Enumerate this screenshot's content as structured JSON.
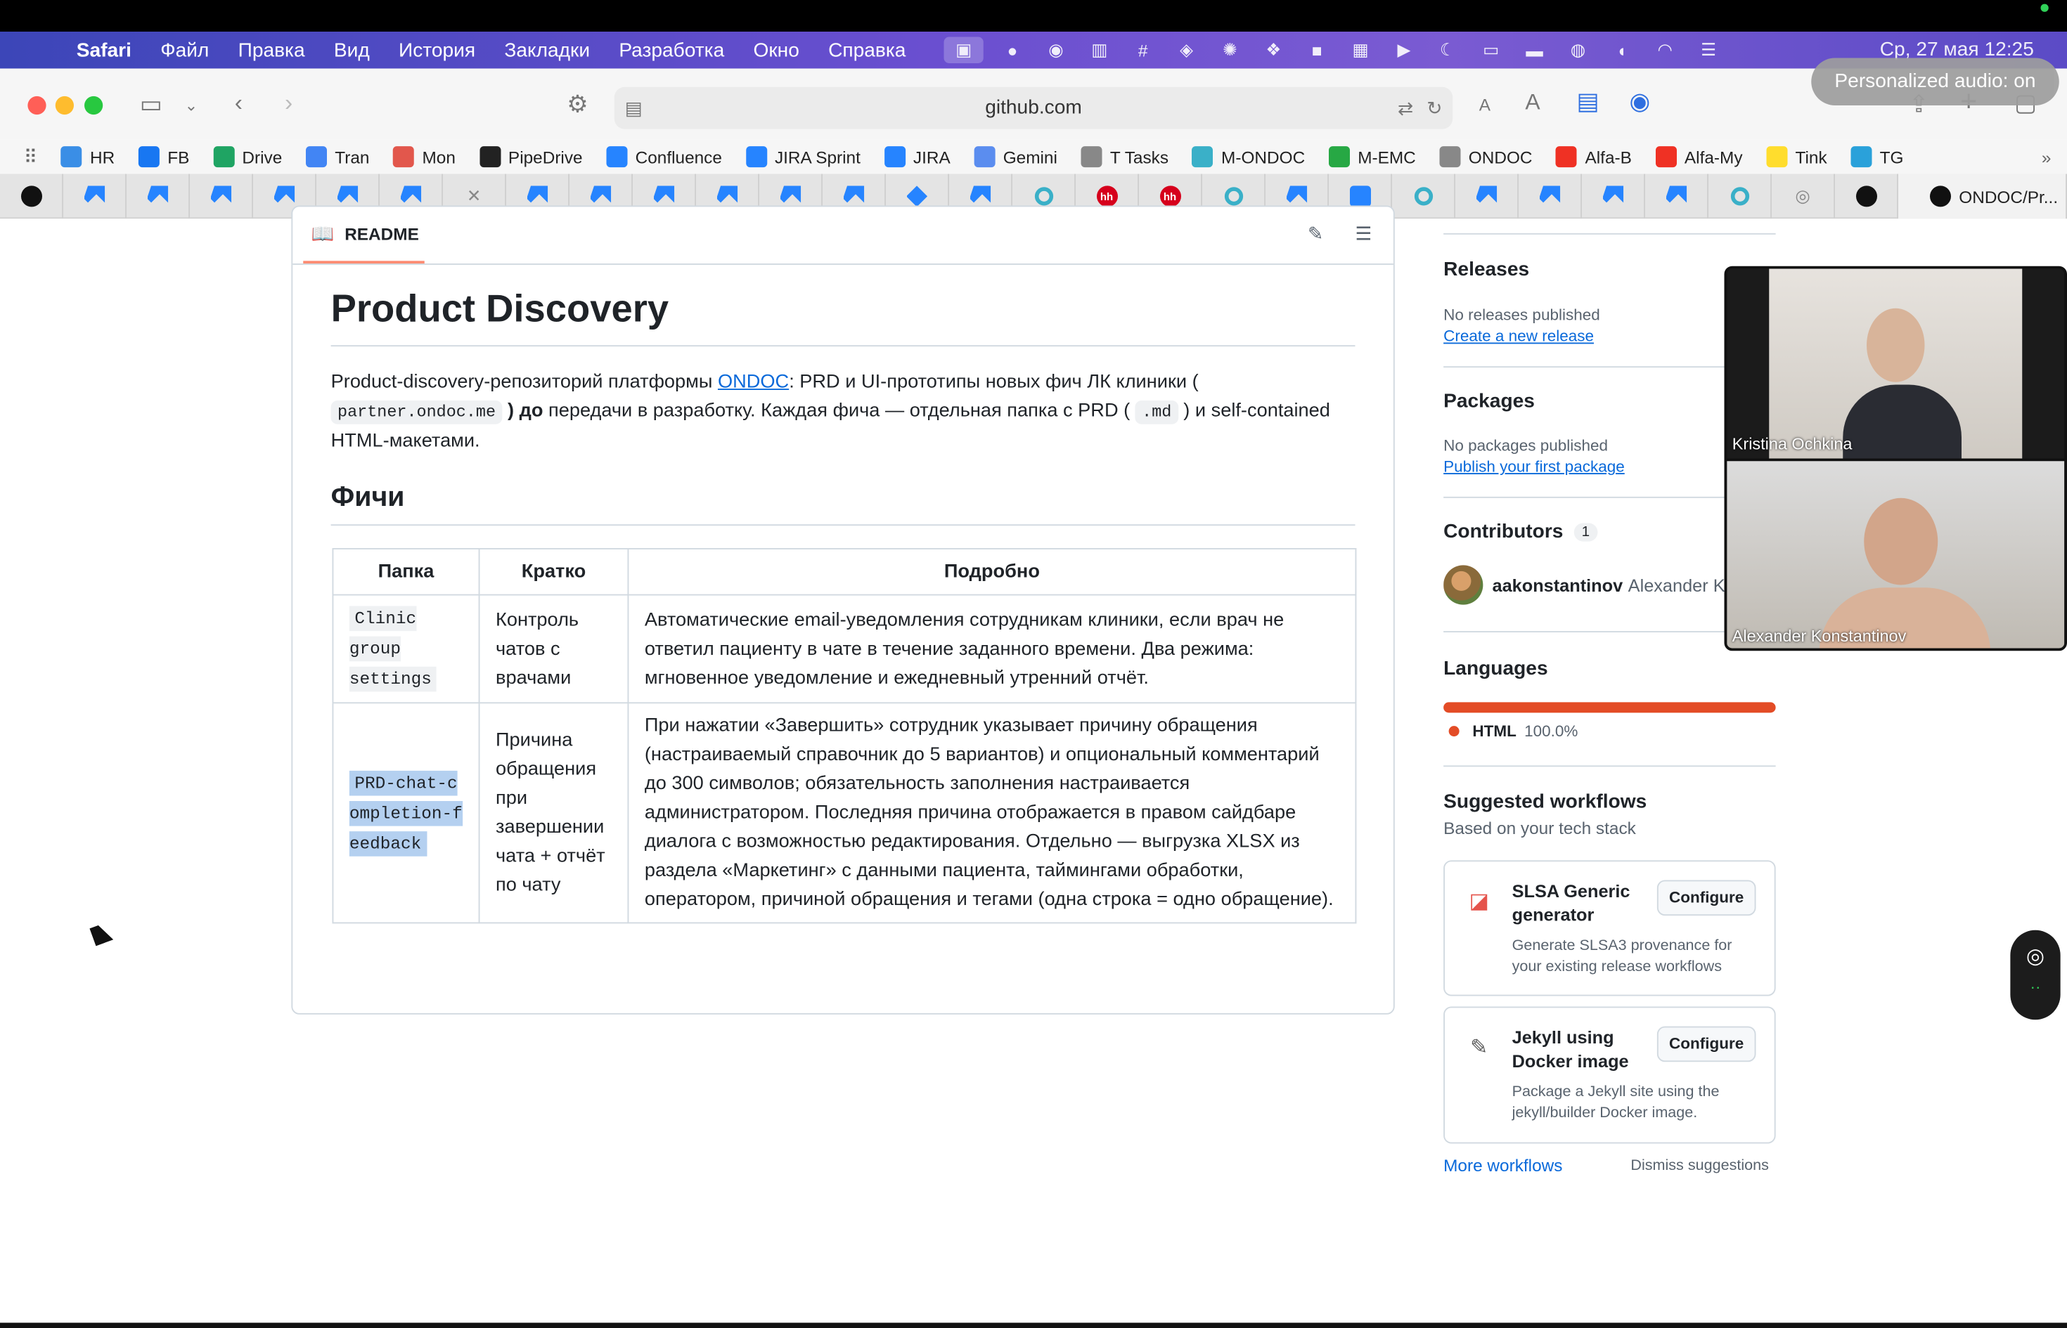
{
  "menubar": {
    "app": "Safari",
    "items": [
      "Файл",
      "Правка",
      "Вид",
      "История",
      "Закладки",
      "Разработка",
      "Окно",
      "Справка"
    ],
    "clock": "Ср, 27 мая  12:25"
  },
  "toolbar": {
    "url": "github.com",
    "personalized_audio": "Personalized audio: on"
  },
  "bookmarks": [
    {
      "label": "HR",
      "icon": "hr-icon",
      "color": "#3a8ee6"
    },
    {
      "label": "FB",
      "icon": "facebook-icon",
      "color": "#1877f2"
    },
    {
      "label": "Drive",
      "icon": "drive-icon",
      "color": "#1fa463"
    },
    {
      "label": "Tran",
      "icon": "translate-icon",
      "color": "#4285f4"
    },
    {
      "label": "Mon",
      "icon": "mon-icon",
      "color": "#e2574c"
    },
    {
      "label": "PipeDrive",
      "icon": "pipedrive-icon",
      "color": "#222222"
    },
    {
      "label": "Confluence",
      "icon": "confluence-icon",
      "color": "#2684ff"
    },
    {
      "label": "JIRA Sprint",
      "icon": "jira-icon",
      "color": "#2684ff"
    },
    {
      "label": "JIRA",
      "icon": "jira-icon",
      "color": "#2684ff"
    },
    {
      "label": "Gemini",
      "icon": "gemini-icon",
      "color": "#5b8def"
    },
    {
      "label": "T Tasks",
      "icon": "folder-icon",
      "color": "#888888"
    },
    {
      "label": "M-ONDOC",
      "icon": "circle-icon",
      "color": "#3ab0c8"
    },
    {
      "label": "M-EMC",
      "icon": "grid-icon",
      "color": "#27a844"
    },
    {
      "label": "ONDOC",
      "icon": "folder-icon",
      "color": "#888888"
    },
    {
      "label": "Alfa-B",
      "icon": "alfa-icon",
      "color": "#ef3124"
    },
    {
      "label": "Alfa-My",
      "icon": "alfa-icon",
      "color": "#ef3124"
    },
    {
      "label": "Tink",
      "icon": "tinkoff-icon",
      "color": "#ffdd2d"
    },
    {
      "label": "TG",
      "icon": "telegram-icon",
      "color": "#2aa1da"
    }
  ],
  "tabs": {
    "active_label": "ONDOC/Pr..."
  },
  "readme": {
    "tab_label": "README",
    "title": "Product Discovery",
    "intro_pre": "Product-discovery-репозиторий платформы ",
    "intro_link": "ONDOC",
    "intro_mid": ": PRD и UI-прототипы новых фич ЛК клиники ( ",
    "intro_code1": "partner.ondoc.me",
    "intro_bold": " ) до",
    "intro_mid2": " передачи в разработку. Каждая фича — отдельная папка с PRD ( ",
    "intro_code2": ".md",
    "intro_post": " ) и self-contained HTML-макетами.",
    "features_heading": "Фичи",
    "table": {
      "headers": [
        "Папка",
        "Кратко",
        "Подробно"
      ],
      "rows": [
        {
          "folder": "Clinic group settings",
          "short": "Контроль чатов с врачами",
          "detail": "Автоматические email-уведомления сотрудникам клиники, если врач не ответил пациенту в чате в течение заданного времени. Два режима: мгновенное уведомление и ежедневный утренний отчёт."
        },
        {
          "folder": "PRD-chat-completion-feedback",
          "short": "Причина обращения при завершении чата + отчёт по чату",
          "detail": "При нажатии «Завершить» сотрудник указывает причину обращения (настраиваемый справочник до 5 вариантов) и опциональный комментарий до 300 символов; обязательность заполнения настраивается администратором. Последняя причина отображается в правом сайдбаре диалога с возможностью редактирования. Отдельно — выгрузка XLSX из раздела «Маркетинг» с данными пациента, таймингами обработки, оператором, причиной обращения и тегами (одна строка = одно обращение)."
        }
      ]
    }
  },
  "sidebar": {
    "releases_title": "Releases",
    "releases_text": "No releases published",
    "releases_link": "Create a new release",
    "packages_title": "Packages",
    "packages_text": "No packages published",
    "packages_link": "Publish your first package",
    "contributors_title": "Contributors",
    "contributors_count": "1",
    "contributor_login": "aakonstantinov",
    "contributor_name": "Alexander Ko",
    "languages_title": "Languages",
    "language_name": "HTML",
    "language_percent": "100.0%",
    "language_color": "#e34c26",
    "workflows_title": "Suggested workflows",
    "workflows_subtitle": "Based on your tech stack",
    "workflows": [
      {
        "title": "SLSA Generic generator",
        "desc": "Generate SLSA3 provenance for your existing release workflows",
        "button": "Configure"
      },
      {
        "title": "Jekyll using Docker image",
        "desc": "Package a Jekyll site using the jekyll/builder Docker image.",
        "button": "Configure"
      }
    ],
    "more_workflows": "More workflows",
    "dismiss": "Dismiss suggestions"
  },
  "video_call": {
    "participants": [
      "Kristina Ochkina",
      "Alexander Konstantinov"
    ]
  }
}
